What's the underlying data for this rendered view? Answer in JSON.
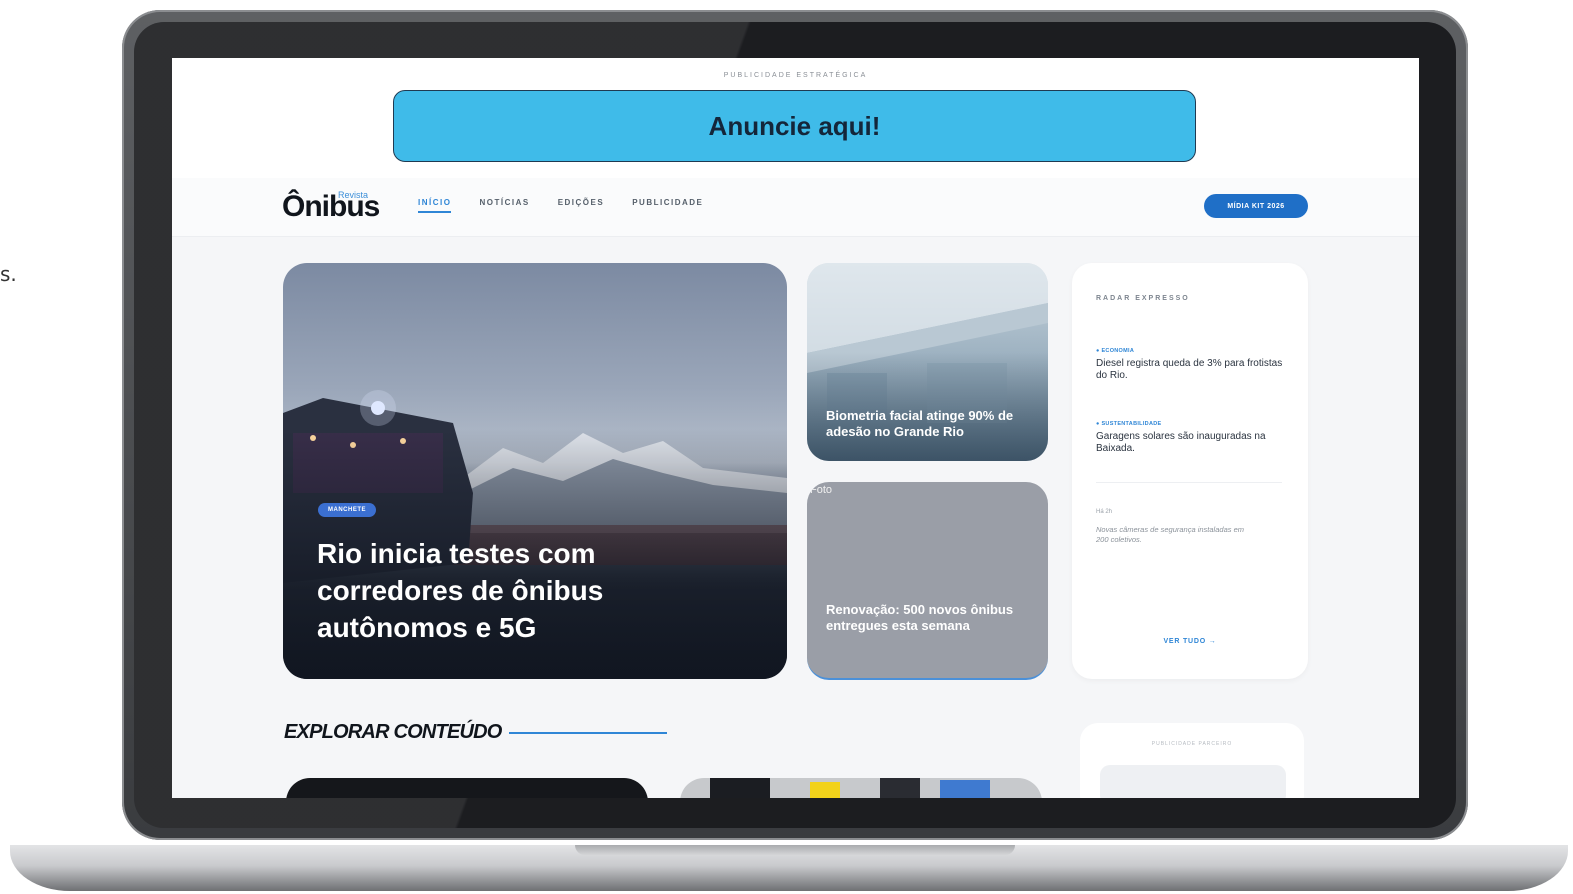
{
  "stray_text": "s.",
  "ad": {
    "label": "PUBLICIDADE ESTRATÉGICA",
    "banner_text": "Anuncie aqui!"
  },
  "header": {
    "logo_main": "Ônibus",
    "logo_small": "Revista",
    "nav": [
      "INÍCIO",
      "NOTÍCIAS",
      "EDIÇÕES",
      "PUBLICIDADE"
    ],
    "cta": "MÍDIA KIT 2026"
  },
  "hero": {
    "badge": "MANCHETE",
    "title": "Rio inicia testes com corredores de ônibus autônomos e 5G"
  },
  "cards": {
    "biometry_title": "Biometria facial atinge 90% de adesão no Grande Rio",
    "renovation_alt": "Foto",
    "renovation_title": "Renovação: 500 novos ônibus entregues esta semana"
  },
  "radar": {
    "title": "RADAR EXPRESSO",
    "items": [
      {
        "tag": "● ECONOMIA",
        "text": "Diesel registra queda de 3% para frotistas do Rio."
      },
      {
        "tag": "● SUSTENTABILIDADE",
        "text": "Garagens solares são inauguradas na Baixada."
      }
    ],
    "time": "Há 2h",
    "quote": "Novas câmeras de segurança instaladas em 200 coletivos.",
    "see_all": "VER TUDO →"
  },
  "explore": {
    "title": "EXPLORAR CONTEÚDO",
    "ad_box_label": "PUBLICIDADE PARCEIRO"
  },
  "colors": {
    "accent": "#2f86d6",
    "banner": "#3fbbe9",
    "cta": "#1f6fc7",
    "dark_text": "#10151c"
  }
}
